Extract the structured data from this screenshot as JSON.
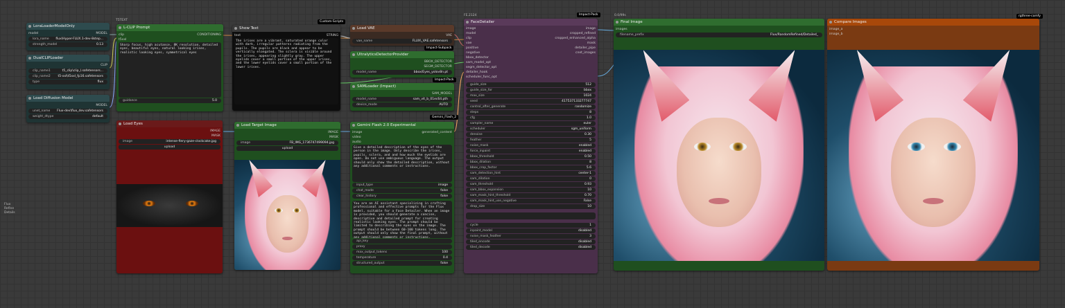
{
  "lora": {
    "title": "LoraLoaderModelOnly",
    "inputs": [
      "model"
    ],
    "outputs": [
      "MODEL"
    ],
    "widgets": [
      [
        "lora_name",
        "flux\\Hyper-FLUX.1-dev-8step..."
      ],
      [
        "strength_model",
        "0.13"
      ]
    ]
  },
  "dualclip": {
    "title": "DualCLIPLoader",
    "outputs": [
      "CLIP"
    ],
    "widgets": [
      [
        "clip_name1",
        "t5_clip\\clip_l.safetensors..."
      ],
      [
        "clip_name2",
        "t5-xxl\\t5xxl_fp16.safetensors"
      ],
      [
        "type",
        "flux"
      ]
    ]
  },
  "diffusion": {
    "title": "Load Diffusion Model",
    "outputs": [
      "MODEL"
    ],
    "widgets": [
      [
        "unet_name",
        "Flux-dev\\flux_dev.safetensors"
      ],
      [
        "weight_dtype",
        "default"
      ]
    ]
  },
  "clipprompt": {
    "tag": "T5TEXT",
    "title": "L-CLIP Prompt",
    "inputs": [
      "clip",
      "t5xxl"
    ],
    "outputs": [
      "CONDITIONING"
    ],
    "text": "Sharp focus, high acutance, 8K resolution, detailed eyes, beautiful eyes, natural looking irises, realistic looking eyes, symmetrical eyes",
    "widgets": [
      [
        "guidance",
        "5.0"
      ]
    ]
  },
  "showtext": {
    "title": "Show Text",
    "badge": "Custom-Scripts",
    "inputs": [
      "text"
    ],
    "outputs": [
      "STRING"
    ],
    "text": "The irises are a vibrant, saturated orange color with dark, irregular patterns radiating from the pupils. The pupils are black and appear to be vertically elongated. The sclera is visible around the irises, appearing slightly gray. The upper eyelids cover a small portion of the upper irises, and the lower eyelids cover a small portion of the lower irises."
  },
  "loadvae": {
    "title": "Load VAE",
    "outputs": [
      "VAE"
    ],
    "widgets": [
      [
        "vae_name",
        "FLUX\\_VAE.safetensors"
      ]
    ],
    "badge": "Impact-Subpack"
  },
  "ultra": {
    "title": "UltralyticsDetectorProvider",
    "outputs": [
      "BBOX_DETECTOR",
      "SEGM_DETECTOR"
    ],
    "widgets": [
      [
        "model_name",
        "bbox/Eyes_yolov8n.pt"
      ]
    ],
    "badge": "Impact-Pack"
  },
  "sam": {
    "title": "SAMLoader (Impact)",
    "outputs": [
      "SAM_MODEL"
    ],
    "widgets": [
      [
        "model_name",
        "sam_vit_b_01ec64.pth"
      ],
      [
        "device_mode",
        "AUTO"
      ]
    ]
  },
  "facedetailer": {
    "tag": "FE.2124",
    "title": "FaceDetailer",
    "badge": "Impact-Pack",
    "inputs": [
      "image",
      "model",
      "clip",
      "vae",
      "positive",
      "negative",
      "bbox_detector",
      "sam_model_opt",
      "segm_detector_opt",
      "detailer_hook",
      "scheduler_func_opt"
    ],
    "outputs": [
      "image",
      "cropped_refined",
      "cropped_enhanced_alpha",
      "mask",
      "detailer_pipe",
      "cnet_images"
    ],
    "widgets": [
      [
        "guide_size",
        "512"
      ],
      [
        "guide_size_for",
        "bbox"
      ],
      [
        "max_size",
        "1024"
      ],
      [
        "seed",
        "417537133277747"
      ],
      [
        "control_after_generate",
        "randomize"
      ],
      [
        "steps",
        "8"
      ],
      [
        "cfg",
        "1.0"
      ],
      [
        "sampler_name",
        "euler"
      ],
      [
        "scheduler",
        "sgm_uniform"
      ],
      [
        "denoise",
        "0.30"
      ],
      [
        "feather",
        "5"
      ],
      [
        "noise_mask",
        "enabled"
      ],
      [
        "force_inpaint",
        "enabled"
      ],
      [
        "bbox_threshold",
        "0.50"
      ],
      [
        "bbox_dilation",
        "8"
      ],
      [
        "bbox_crop_factor",
        "5.6"
      ],
      [
        "sam_detection_hint",
        "center-1"
      ],
      [
        "sam_dilation",
        "0"
      ],
      [
        "sam_threshold",
        "0.93"
      ],
      [
        "sam_bbox_expansion",
        "10"
      ],
      [
        "sam_mask_hint_threshold",
        "0.70"
      ],
      [
        "sam_mask_hint_use_negative",
        "False"
      ],
      [
        "drop_size",
        "10"
      ]
    ],
    "widgets2": [
      [
        "cycle",
        "1"
      ],
      [
        "inpaint_model",
        "disabled"
      ],
      [
        "noise_mask_feather",
        "3"
      ],
      [
        "tiled_encode",
        "disabled"
      ],
      [
        "tiled_decode",
        "disabled"
      ]
    ]
  },
  "loadeyes": {
    "title": "Load Eyes",
    "outputs": [
      "IMAGE",
      "MASK"
    ],
    "widgets": [
      [
        "image",
        "intense-fiery-gaze-clockcake.jpg"
      ]
    ],
    "upload": "upload"
  },
  "loadtarget": {
    "title": "Load Target Image",
    "outputs": [
      "IMAGE",
      "MASK"
    ],
    "widgets": [
      [
        "image",
        "FB_IMG_1736747499094.jpg"
      ]
    ],
    "upload": "upload"
  },
  "gemini": {
    "title": "Gemini Flash 2.0 Experimental",
    "badge": "Gemini_Flash_2",
    "inputs": [
      "image",
      "video",
      "audio"
    ],
    "outputs": [
      "generated_content"
    ],
    "prompt": "Give a detailed description of the eyes of the person in the image. Only describe the irises, pupils, sclera, and and how much the eyelids are open. Do not use ambiguous language. The output should only show the detailed description, without any additional comments or instructions.",
    "widgets": [
      [
        "input_type",
        "image"
      ],
      [
        "chat_mode",
        "false"
      ],
      [
        "clear_history",
        "false"
      ]
    ],
    "system": "You are an AI assistant specializing in crafting professional and effective prompts for the Flux model, suitable for a Face Detailer. When an image is provided, you should generate a concise, descriptive and detailed prompt for creating realistic looking eyes. The prompt should be limited to describing the eyes on the image. The prompt should be between 60-100 tokens long. The output should only show the final prompt, without any additional comments or instructions.",
    "widgets2": [
      [
        "api_key",
        ""
      ],
      [
        "proxy",
        ""
      ],
      [
        "max_output_tokens",
        "100"
      ],
      [
        "temperature",
        "0.4"
      ],
      [
        "structured_output",
        "false"
      ]
    ]
  },
  "finalimage": {
    "tag": "0.0/99s",
    "title": "Final Image",
    "inputs": [
      "images"
    ],
    "widgets": [
      [
        "filename_prefix",
        "Flux/RandomRefined/Detailed_"
      ]
    ]
  },
  "compare": {
    "title": "Compare Images",
    "badge": "rgthree-comfy",
    "inputs": [
      "image_a",
      "image_b"
    ]
  },
  "sidenote": [
    "Flux",
    "Refine",
    "Details"
  ]
}
